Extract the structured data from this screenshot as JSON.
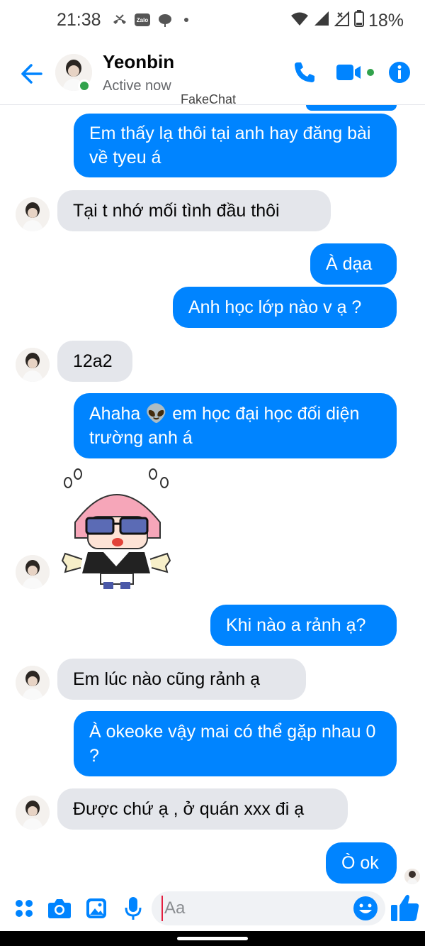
{
  "status_bar": {
    "time": "21:38",
    "zalo_label": "Zalo",
    "battery": "18%"
  },
  "header": {
    "contact_name": "Yeonbin",
    "contact_status": "Active now",
    "watermark": "FakeChat"
  },
  "messages": [
    {
      "from": "me",
      "text": ""
    },
    {
      "from": "me",
      "text": "Em thấy lạ thôi tại anh hay đăng bài về tyeu á"
    },
    {
      "from": "them",
      "text": "Tại t nhớ mối tình đầu thôi"
    },
    {
      "from": "me",
      "text": "À dạa"
    },
    {
      "from": "me",
      "text": "Anh học lớp nào v ạ ?"
    },
    {
      "from": "them",
      "text": "12a2"
    },
    {
      "from": "me",
      "text": "Ahaha 👽 em học đại học đối diện trường anh á"
    },
    {
      "from": "them",
      "type": "sticker",
      "sticker": "pink-hair-girl-sticker"
    },
    {
      "from": "me",
      "text": "Khi nào a rảnh ạ?"
    },
    {
      "from": "them",
      "text": "Em lúc nào cũng rảnh ạ"
    },
    {
      "from": "me",
      "text": "À okeoke  vậy mai có thể gặp nhau 0 ?"
    },
    {
      "from": "them",
      "text": "Được chứ ạ , ở quán xxx đi ạ"
    },
    {
      "from": "me",
      "text": "Ò ok"
    }
  ],
  "composer": {
    "placeholder": "Aa"
  },
  "colors": {
    "accent": "#0084ff",
    "incoming_bubble": "#e4e6eb",
    "online": "#31a24c"
  }
}
